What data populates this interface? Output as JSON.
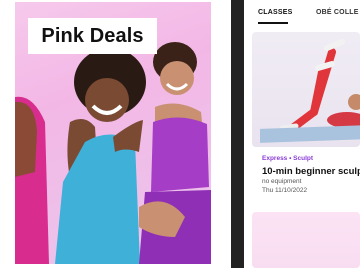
{
  "promo": {
    "badge_text": "Pink Deals"
  },
  "app": {
    "tabs": [
      "CLASSES",
      "OBÉ COLLE"
    ],
    "class_card": {
      "category": "Express • Sculpt",
      "title": "10-min beginner sculp",
      "equipment": "no equipment",
      "date": "Thu 11/10/2022"
    }
  },
  "colors": {
    "promo_bg": "#f3b7e6",
    "category": "#8a3bd6",
    "phone_frame": "#222222"
  }
}
